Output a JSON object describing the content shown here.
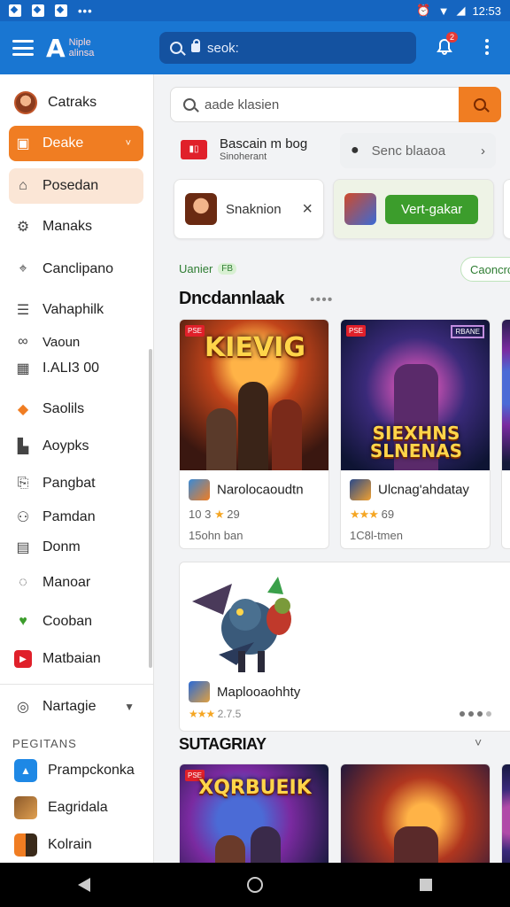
{
  "status_bar": {
    "time_text": "•••",
    "battery": "12:53"
  },
  "app_bar": {
    "logo_letter": "A",
    "logo_line1": "Niple",
    "logo_line2": "alinsa",
    "search_placeholder": "seok:",
    "notification_count": "2"
  },
  "sidebar": {
    "items": [
      {
        "label": "Catraks",
        "icon": "user-avatar-icon"
      },
      {
        "label": "Deake",
        "icon": "store-icon"
      },
      {
        "label": "Posedan",
        "icon": "home-icon"
      },
      {
        "label": "Manaks",
        "icon": "settings-icon"
      },
      {
        "label": "Canclipano",
        "icon": "location-icon"
      },
      {
        "label": "Vahaphilk",
        "icon": "list-icon"
      },
      {
        "label": "Vaoun",
        "icon": "link-icon"
      },
      {
        "label": "I.ALI3 00",
        "icon": "calendar-icon"
      },
      {
        "label": "Saolils",
        "icon": "game-icon"
      },
      {
        "label": "Aoypks",
        "icon": "building-icon"
      },
      {
        "label": "Pangbat",
        "icon": "bookmark-icon"
      },
      {
        "label": "Pamdan",
        "icon": "people-icon"
      },
      {
        "label": "Donm",
        "icon": "window-icon"
      },
      {
        "label": "Manoar",
        "icon": "chat-icon"
      },
      {
        "label": "Cooban",
        "icon": "heart-icon"
      },
      {
        "label": "Matbaian",
        "icon": "movie-icon"
      },
      {
        "label": "Nartagie",
        "icon": "search-circle-icon"
      }
    ],
    "section_label": "PEGITANS",
    "apps": [
      {
        "label": "Prampckonka"
      },
      {
        "label": "Eagridala"
      },
      {
        "label": "Kolrain"
      }
    ]
  },
  "content": {
    "search_placeholder": "aade klasien",
    "brand_name": "Bascain m bog",
    "brand_sub": "Sinoherant",
    "select_label": "Senc blaaoa",
    "chip1_label": "Snaknion",
    "chip2_button": "Vert-gakar",
    "tag_text": "Uanier",
    "tag_badge": "FB",
    "outline_pill": "Caoncrc",
    "section1_title": "Dncdannlaak",
    "section1_more": "••••",
    "cards": [
      {
        "art_title": "KIEVIG",
        "corner": "PSE",
        "title": "Narolocaoudtn",
        "rating_num": "10 3",
        "rating": "29",
        "sub": "15ohn ban"
      },
      {
        "art_title": "SIEXHNS SLNENAS",
        "corner": "PSE",
        "corner2": "RBANE",
        "title": "Ulcnag'ahdatay",
        "rating_num": "",
        "rating": "69",
        "sub": "1C8l-tmen"
      }
    ],
    "wide_card": {
      "title": "Maplooaohhty",
      "rating_text": "2.7.5"
    },
    "section2_title": "SUTAGRIAY",
    "cards2": [
      {
        "art_title": "XQRBUEIK",
        "corner": "PSE"
      },
      {
        "art_title": "",
        "corner": ""
      }
    ]
  },
  "colors": {
    "primary": "#1976d2",
    "accent": "#f07d22",
    "green": "#3c9d2c"
  }
}
